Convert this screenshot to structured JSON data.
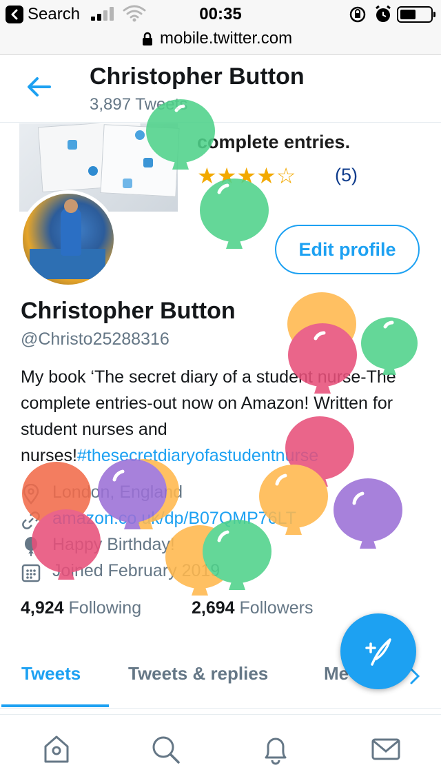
{
  "status_bar": {
    "back_app_label": "Search",
    "time": "00:35"
  },
  "url_bar": {
    "url": "mobile.twitter.com"
  },
  "header": {
    "name": "Christopher Button",
    "tweet_count": "3,897 Tweets"
  },
  "banner": {
    "text": "complete entries.",
    "rating_stars": 4,
    "rating_count": "(5)"
  },
  "profile": {
    "edit_button": "Edit profile",
    "name": "Christopher Button",
    "handle": "@Christo25288316",
    "bio_text": "My book ‘The secret diary of a student nurse-The complete entries-out now on Amazon! Written for student nurses and nurses!",
    "bio_hashtag": "#thesecretdiaryofastudentnurse",
    "location": "London, England",
    "website": "amazon.co.uk/dp/B07QMP76LT",
    "birthday": "Happy Birthday!",
    "joined": "Joined February 2019",
    "following_count": "4,924",
    "following_label": "Following",
    "followers_count": "2,694",
    "followers_label": "Followers"
  },
  "tabs": {
    "tweets": "Tweets",
    "replies": "Tweets & replies",
    "media": "Me"
  },
  "icons": {
    "back": "arrow-left-icon",
    "location": "location-pin-icon",
    "link": "link-icon",
    "birthday": "balloon-icon",
    "calendar": "calendar-icon",
    "compose": "compose-tweet-icon",
    "home": "home-icon",
    "search": "search-icon",
    "notifications": "bell-icon",
    "messages": "mail-icon"
  },
  "colors": {
    "accent": "#1da1f2",
    "muted": "#657786",
    "balloon_green": "#4fd28a",
    "balloon_orange": "#ffb84d",
    "balloon_pink": "#e8507a",
    "balloon_purple": "#9b70d6",
    "balloon_coral": "#f26b4a"
  }
}
